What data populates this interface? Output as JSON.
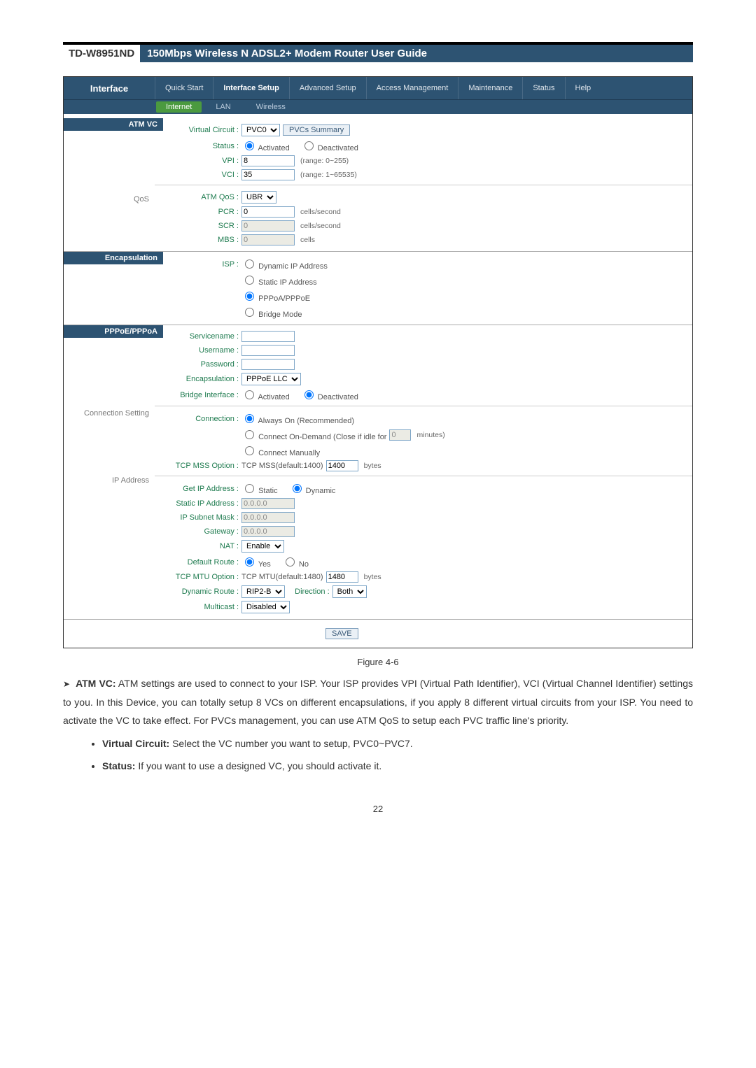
{
  "doc": {
    "model": "TD-W8951ND",
    "title": "150Mbps Wireless N ADSL2+ Modem Router User Guide",
    "figure": "Figure 4-6",
    "para1_label": "ATM VC:",
    "para1": "ATM settings are used to connect to your ISP. Your ISP provides VPI (Virtual Path Identifier), VCI (Virtual Channel Identifier) settings to you. In this Device, you can totally setup 8 VCs on different encapsulations, if you apply 8 different virtual circuits from your ISP. You need to activate the VC to take effect. For PVCs management, you can use ATM QoS to setup each PVC traffic line's priority.",
    "bullet_vc_label": "Virtual Circuit:",
    "bullet_vc": "Select the VC number you want to setup, PVC0~PVC7.",
    "bullet_status_label": "Status:",
    "bullet_status": "If you want to use a designed VC, you should activate it.",
    "page_num": "22"
  },
  "nav": {
    "side_label": "Interface",
    "items": [
      "Quick Start",
      "Interface Setup",
      "Advanced Setup",
      "Access Management",
      "Maintenance",
      "Status",
      "Help"
    ],
    "sub": [
      "Internet",
      "LAN",
      "Wireless"
    ]
  },
  "sections": {
    "atm_vc": "ATM VC",
    "qos": "QoS",
    "encap": "Encapsulation",
    "pppoe": "PPPoE/PPPoA",
    "conn": "Connection Setting",
    "ipaddr": "IP Address"
  },
  "atm": {
    "vc_label": "Virtual Circuit :",
    "vc_sel": "PVC0",
    "pvcs_btn": "PVCs Summary",
    "status_label": "Status :",
    "status_act": "Activated",
    "status_deact": "Deactivated",
    "vpi_label": "VPI :",
    "vpi_val": "8",
    "vpi_hint": "(range: 0~255)",
    "vci_label": "VCI :",
    "vci_val": "35",
    "vci_hint": "(range: 1~65535)"
  },
  "qos": {
    "atmqos_label": "ATM QoS :",
    "atmqos_sel": "UBR",
    "pcr_label": "PCR :",
    "pcr_val": "0",
    "pcr_unit": "cells/second",
    "scr_label": "SCR :",
    "scr_val": "0",
    "scr_unit": "cells/second",
    "mbs_label": "MBS :",
    "mbs_val": "0",
    "mbs_unit": "cells"
  },
  "encap": {
    "isp_label": "ISP :",
    "opt_dyn": "Dynamic IP Address",
    "opt_static": "Static IP Address",
    "opt_pppoe": "PPPoA/PPPoE",
    "opt_bridge": "Bridge Mode"
  },
  "ppp": {
    "svc_label": "Servicename :",
    "user_label": "Username :",
    "pass_label": "Password :",
    "encap_label": "Encapsulation :",
    "encap_sel": "PPPoE LLC",
    "bridge_label": "Bridge Interface :",
    "bridge_act": "Activated",
    "bridge_deact": "Deactivated"
  },
  "conn": {
    "conn_label": "Connection :",
    "opt_always": "Always On (Recommended)",
    "opt_demand_pre": "Connect On-Demand (Close if idle for",
    "opt_demand_val": "0",
    "opt_demand_post": "minutes)",
    "opt_manual": "Connect Manually",
    "mss_label": "TCP MSS Option :",
    "mss_text": "TCP MSS(default:1400)",
    "mss_val": "1400",
    "mss_unit": "bytes"
  },
  "ip": {
    "getip_label": "Get IP Address :",
    "opt_static": "Static",
    "opt_dynamic": "Dynamic",
    "sip_label": "Static IP Address :",
    "sip_val": "0.0.0.0",
    "mask_label": "IP Subnet Mask :",
    "mask_val": "0.0.0.0",
    "gw_label": "Gateway :",
    "gw_val": "0.0.0.0",
    "nat_label": "NAT :",
    "nat_sel": "Enable",
    "droute_label": "Default Route :",
    "yes": "Yes",
    "no": "No",
    "mtu_label": "TCP MTU Option :",
    "mtu_text": "TCP MTU(default:1480)",
    "mtu_val": "1480",
    "mtu_unit": "bytes",
    "dynroute_label": "Dynamic Route :",
    "dynroute_sel": "RIP2-B",
    "dir_label": "Direction :",
    "dir_sel": "Both",
    "multicast_label": "Multicast :",
    "multicast_sel": "Disabled"
  },
  "save_btn": "SAVE"
}
